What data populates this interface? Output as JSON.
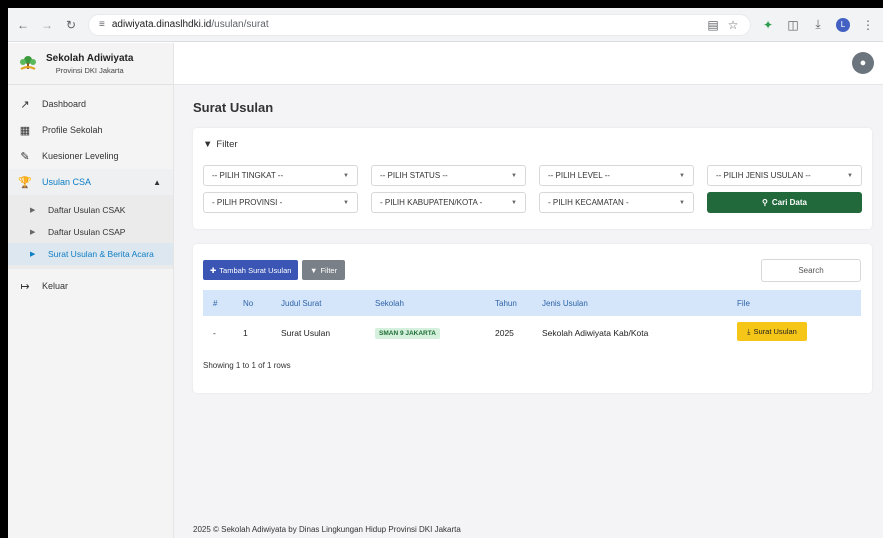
{
  "browser": {
    "url_host": "adiwiyata.dinaslhdki.id",
    "url_path": "/usulan/surat"
  },
  "brand": {
    "title": "Sekolah Adiwiyata",
    "subtitle": "Provinsi DKI Jakarta"
  },
  "sidebar": {
    "items": [
      {
        "label": "Dashboard",
        "icon": "chart-line-icon"
      },
      {
        "label": "Profile Sekolah",
        "icon": "building-icon"
      },
      {
        "label": "Kuesioner Leveling",
        "icon": "edit-icon"
      },
      {
        "label": "Usulan CSA",
        "icon": "trophy-icon"
      }
    ],
    "sub_items": [
      {
        "label": "Daftar Usulan CSAK"
      },
      {
        "label": "Daftar Usulan CSAP"
      },
      {
        "label": "Surat Usulan & Berita Acara"
      }
    ],
    "logout": "Keluar"
  },
  "page": {
    "title": "Surat Usulan"
  },
  "filter": {
    "heading": "Filter",
    "tingkat": "-- PILIH TINGKAT --",
    "status": "-- PILIH STATUS --",
    "level": "-- PILIH LEVEL --",
    "jenis": "-- PILIH JENIS USULAN --",
    "provinsi": "- PILIH PROVINSI -",
    "kabupaten": "- PILIH KABUPATEN/KOTA -",
    "kecamatan": "- PILIH KECAMATAN -",
    "search_button": "Cari Data"
  },
  "table": {
    "add_button": "Tambah Surat Usulan",
    "filter_button": "Filter",
    "search_placeholder": "Search",
    "headers": [
      "#",
      "No",
      "Judul Surat",
      "Sekolah",
      "Tahun",
      "Jenis Usulan",
      "File"
    ],
    "rows": [
      {
        "hash": "-",
        "no": "1",
        "judul": "Surat Usulan",
        "sekolah": "SMAN 9 JAKARTA",
        "tahun": "2025",
        "jenis": "Sekolah Adiwiyata Kab/Kota",
        "file": "Surat Usulan"
      }
    ],
    "showing": "Showing 1 to 1 of 1 rows"
  },
  "footer": "2025 © Sekolah Adiwiyata by Dinas Lingkungan Hidup Provinsi DKI Jakarta",
  "colors": {
    "accent": "#0d7ec4",
    "primary_button": "#3a55b4",
    "success_button": "#21693a",
    "warning_button": "#f5c518",
    "table_header": "#d6e6fa"
  }
}
